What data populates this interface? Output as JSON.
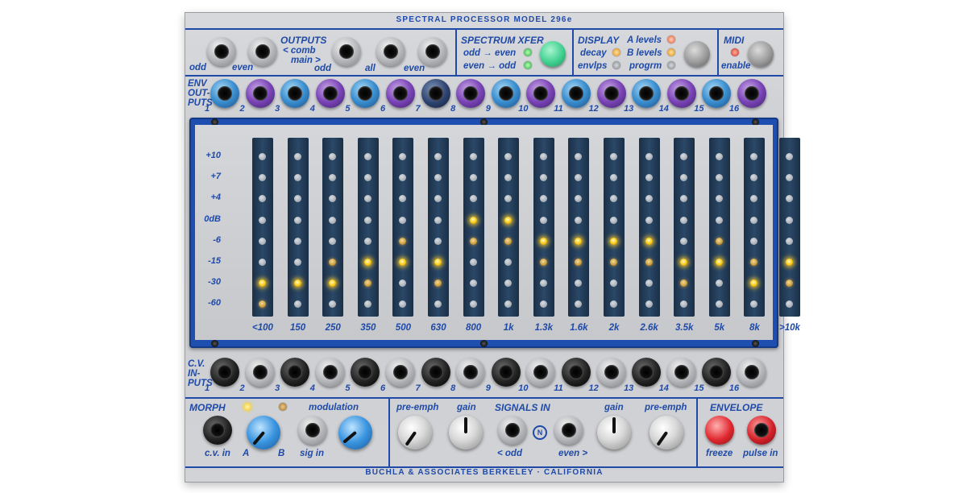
{
  "title": "SPECTRAL PROCESSOR MODEL  296e",
  "footer": "BUCHLA & ASSOCIATES   BERKELEY · CALIFORNIA",
  "outputs": {
    "label": "OUTPUTS",
    "comb_label": "< comb",
    "main_label": "main >",
    "jack_labels": [
      "odd",
      "even",
      "odd",
      "all",
      "even"
    ]
  },
  "spectrum_xfer": {
    "label": "SPECTRUM XFER",
    "odd_even": "odd → even",
    "even_odd": "even → odd"
  },
  "display_section": {
    "label": "DISPLAY",
    "decay": "decay",
    "envlps": "envlps",
    "a_levels": "A levels",
    "b_levels": "B levels",
    "progrm": "progrm"
  },
  "midi": {
    "label": "MIDI",
    "enable": "enable"
  },
  "env_outputs": {
    "label_line1": "ENV",
    "label_line2": "OUT-",
    "label_line3": "PUTS",
    "numbers": [
      "1",
      "2",
      "3",
      "4",
      "5",
      "6",
      "7",
      "8",
      "9",
      "10",
      "11",
      "12",
      "13",
      "14",
      "15",
      "16"
    ]
  },
  "cv_inputs": {
    "label_line1": "C.V.",
    "label_line2": "IN-",
    "label_line3": "PUTS",
    "numbers": [
      "1",
      "2",
      "3",
      "4",
      "5",
      "6",
      "7",
      "8",
      "9",
      "10",
      "11",
      "12",
      "13",
      "14",
      "15",
      "16"
    ]
  },
  "meter": {
    "scale_labels": [
      "+10",
      "+7",
      "+4",
      "0dB",
      "-6",
      "-15",
      "-30",
      "-60"
    ],
    "bands": [
      "<100",
      "150",
      "250",
      "350",
      "500",
      "630",
      "800",
      "1k",
      "1.3k",
      "1.6k",
      "2k",
      "2.6k",
      "3.5k",
      "5k",
      "8k",
      ">10k"
    ],
    "bright_level_index": [
      6,
      6,
      6,
      5,
      5,
      5,
      3,
      3,
      4,
      4,
      4,
      4,
      5,
      5,
      6,
      5
    ],
    "dim_level_index": [
      7,
      null,
      5,
      6,
      4,
      6,
      4,
      4,
      5,
      5,
      5,
      5,
      6,
      4,
      5,
      6
    ]
  },
  "morph": {
    "label": "MORPH",
    "cv_in": "c.v. in",
    "a": "A",
    "b": "B",
    "modulation": "modulation",
    "sig_in": "sig in"
  },
  "signals_in": {
    "label": "SIGNALS IN",
    "pre_emph": "pre-emph",
    "gain": "gain",
    "odd": "< odd",
    "even": "even >",
    "n": "N"
  },
  "signals_in_right": {
    "gain": "gain",
    "pre_emph": "pre-emph"
  },
  "envelope": {
    "label": "ENVELOPE",
    "freeze": "freeze",
    "pulse_in": "pulse in"
  },
  "colors": {
    "accent": "#1f4aa8",
    "led_on": "#ffd21f",
    "xfer_button": "#3fd08f",
    "panel": "#cfd0d3"
  }
}
